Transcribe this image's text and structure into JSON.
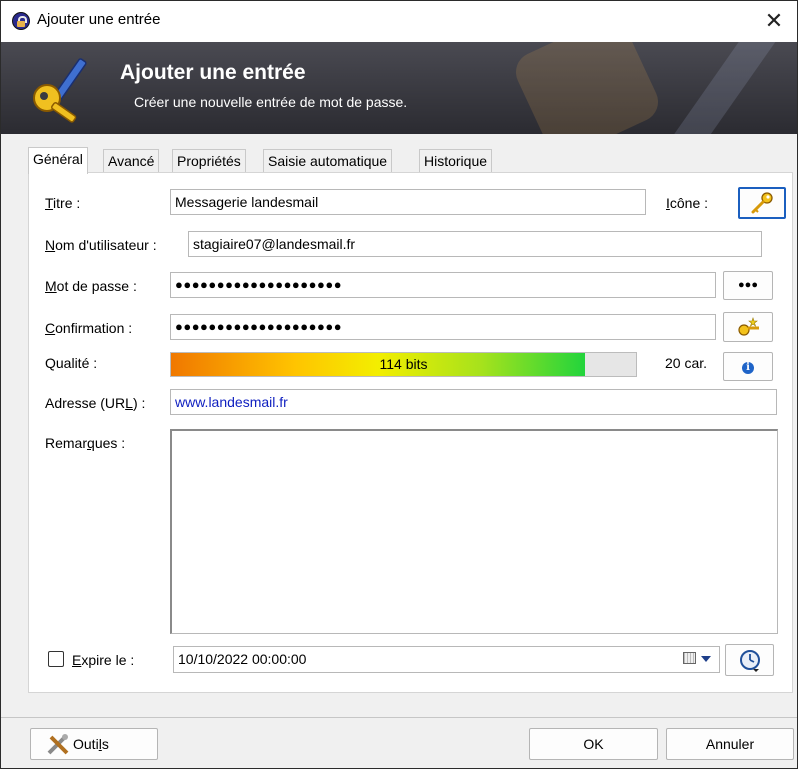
{
  "window": {
    "title": "Ajouter une entrée",
    "close_glyph": "✕"
  },
  "banner": {
    "title": "Ajouter une entrée",
    "subtitle": "Créer une nouvelle entrée de mot de passe."
  },
  "tabs": [
    {
      "label": "Général",
      "active": true
    },
    {
      "label": "Avancé"
    },
    {
      "label": "Propriétés"
    },
    {
      "label": "Saisie automatique"
    },
    {
      "label": "Historique"
    }
  ],
  "form": {
    "title_label": "Titre :",
    "title_value": "Messagerie landesmail",
    "icon_label": "Icône :",
    "username_label": "Nom d'utilisateur :",
    "username_value": "stagiaire07@landesmail.fr",
    "password_label": "Mot de passe :",
    "password_value": "●●●●●●●●●●●●●●●●●●●●",
    "show_password_glyph": "●●●",
    "confirm_label": "Confirmation :",
    "confirm_value": "●●●●●●●●●●●●●●●●●●●●",
    "quality_label": "Qualité :",
    "quality_text": "114 bits",
    "quality_fraction": 0.89,
    "char_count": "20 car.",
    "url_label": "Adresse (URL) :",
    "url_value": "www.landesmail.fr",
    "notes_label": "Remarques :",
    "notes_value": "",
    "expires_label": "Expire le :",
    "expires_checked": false,
    "expires_value": "10/10/2022 00:00:00"
  },
  "buttons": {
    "tools": "Outils",
    "ok": "OK",
    "cancel": "Annuler"
  },
  "icons": {
    "title_bar": "lock-icon",
    "banner": "key-pen-icon",
    "entry_icon": "key-icon",
    "generator": "key-wand-icon",
    "info": "info-icon",
    "calendar": "calendar-icon",
    "expiry_menu": "clock-icon",
    "tools": "tools-icon"
  },
  "colors": {
    "banner_bg": "#37373d",
    "url": "#1020c0",
    "info": "#1f64c8"
  }
}
